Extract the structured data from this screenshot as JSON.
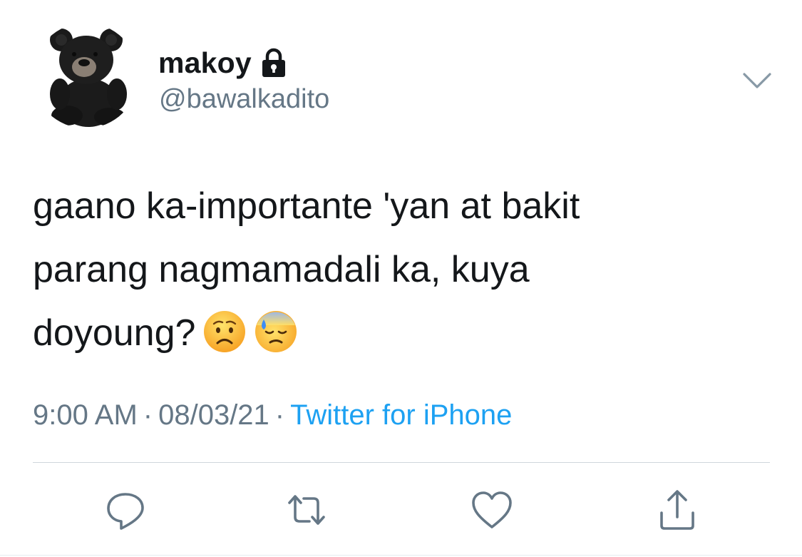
{
  "user": {
    "display_name": "makoy",
    "handle": "@bawalkadito",
    "avatar_icon": "teddy-bear-avatar",
    "protected_icon": "lock-icon"
  },
  "tweet": {
    "text": "gaano ka-importante 'yan at bakit\nparang nagmamadali ka, kuya\ndoyoung?",
    "emojis": [
      "worried-face-emoji",
      "downcast-face-with-sweat-emoji"
    ]
  },
  "meta": {
    "time": "9:00 AM",
    "separator": "·",
    "date": "08/03/21",
    "source": "Twitter for iPhone"
  },
  "actions": {
    "reply_icon": "reply-icon",
    "retweet_icon": "retweet-icon",
    "like_icon": "heart-icon",
    "share_icon": "share-icon"
  },
  "colors": {
    "text": "#14171a",
    "secondary": "#657786",
    "link": "#1da1f2",
    "divider": "#cfd6dc"
  }
}
